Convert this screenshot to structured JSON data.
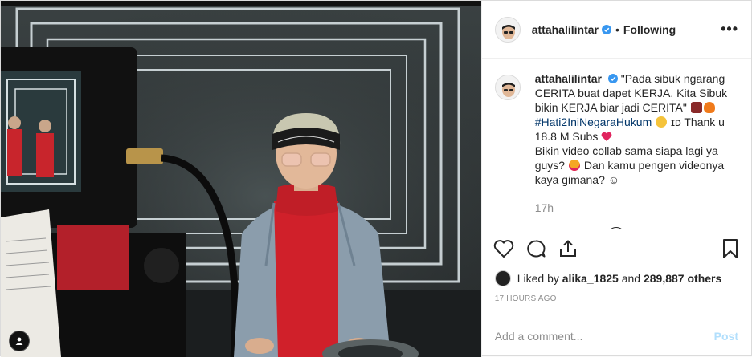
{
  "header": {
    "username": "attahalilintar",
    "dot": "•",
    "follow_status": "Following",
    "more": "•••"
  },
  "caption": {
    "username": "attahalilintar",
    "text_1": "\"Pada sibuk ngarang CERITA buat dapet KERJA. Kita Sibuk bikin KERJA biar jadi CERITA\"",
    "hashtag": "#Hati2IniNegaraHukum",
    "text_2": "ɪᴅ Thank u 18.8 M Subs",
    "text_3": "Bikin video collab sama siapa lagi ya guys?",
    "text_4": "Dan kamu pengen videonya kaya gimana? ☺",
    "time": "17h"
  },
  "likes": {
    "prefix": "Liked by",
    "user": "alika_1825",
    "middle": "and",
    "count": "289,887 others"
  },
  "timestamp": "17 HOURS AGO",
  "comment": {
    "placeholder": "Add a comment...",
    "post_label": "Post"
  },
  "colors": {
    "verified": "#3897f0",
    "hashtag": "#003569",
    "post_disabled": "#b2dffc",
    "heart_red": "#e0245e"
  },
  "icons": [
    "heart-icon",
    "comment-icon",
    "share-icon",
    "bookmark-icon",
    "verified-icon",
    "more-options-icon",
    "user-tag-icon"
  ]
}
